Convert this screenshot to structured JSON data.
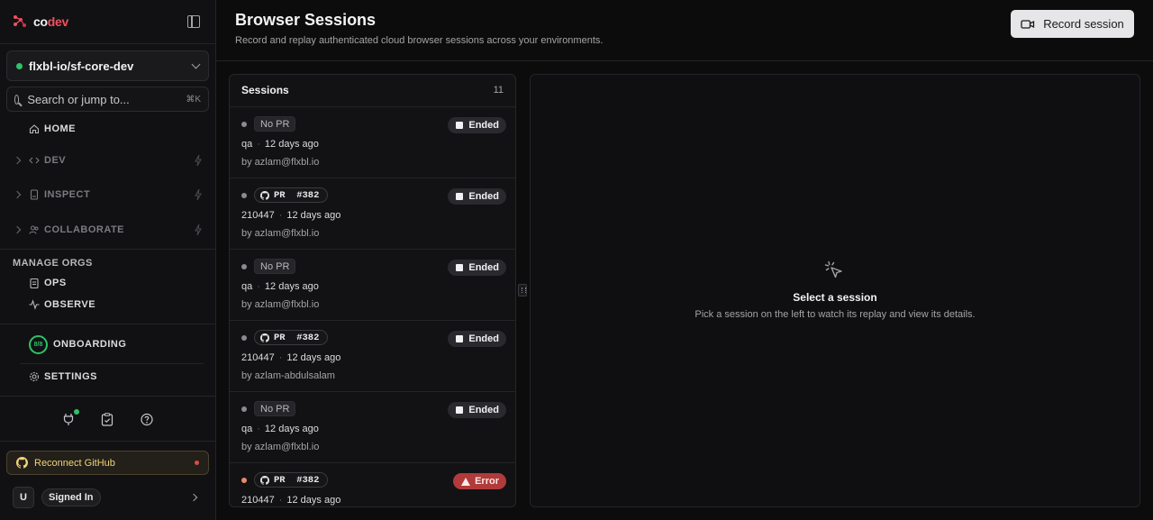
{
  "app": {
    "logo_prefix": "co",
    "logo_suffix": "dev"
  },
  "sidebar": {
    "repo": "flxbl-io/sf-core-dev",
    "search_placeholder": "Search or jump to...",
    "search_shortcut": "⌘K",
    "nav": [
      {
        "label": "HOME",
        "icon": "home-icon"
      },
      {
        "label": "DEV",
        "icon": "code-icon"
      },
      {
        "label": "INSPECT",
        "icon": "inspect-icon"
      },
      {
        "label": "COLLABORATE",
        "icon": "users-icon"
      }
    ],
    "manage_orgs_heading": "MANAGE ORGS",
    "orgs": [
      {
        "label": "OPS",
        "icon": "clipboard-icon"
      },
      {
        "label": "OBSERVE",
        "icon": "activity-icon"
      }
    ],
    "onboarding": {
      "label": "ONBOARDING",
      "progress": "8/8"
    },
    "settings_label": "SETTINGS",
    "reconnect_label": "Reconnect GitHub",
    "user": {
      "avatar": "U",
      "status": "Signed In"
    }
  },
  "header": {
    "title": "Browser Sessions",
    "subtitle": "Record and replay authenticated cloud browser sessions across your environments.",
    "record_button": "Record session"
  },
  "sessions": {
    "title": "Sessions",
    "count": "11",
    "items": [
      {
        "pr": "No PR",
        "branch": "qa",
        "time": "12 days ago",
        "by": "by azlam@flxbl.io",
        "status": "Ended"
      },
      {
        "pr": "PR  #382",
        "branch": "210447",
        "time": "12 days ago",
        "by": "by azlam@flxbl.io",
        "status": "Ended"
      },
      {
        "pr": "No PR",
        "branch": "qa",
        "time": "12 days ago",
        "by": "by azlam@flxbl.io",
        "status": "Ended"
      },
      {
        "pr": "PR  #382",
        "branch": "210447",
        "time": "12 days ago",
        "by": "by azlam-abdulsalam",
        "status": "Ended"
      },
      {
        "pr": "No PR",
        "branch": "qa",
        "time": "12 days ago",
        "by": "by azlam@flxbl.io",
        "status": "Ended"
      },
      {
        "pr": "PR  #382",
        "branch": "210447",
        "time": "12 days ago",
        "by": "",
        "status": "Error"
      }
    ]
  },
  "detail": {
    "empty_title": "Select a session",
    "empty_subtitle": "Pick a session on the left to watch its replay and view its details."
  },
  "colors": {
    "accent_green": "#2ec26a",
    "error_red": "#b13a3a",
    "brand_red": "#f0505f"
  }
}
